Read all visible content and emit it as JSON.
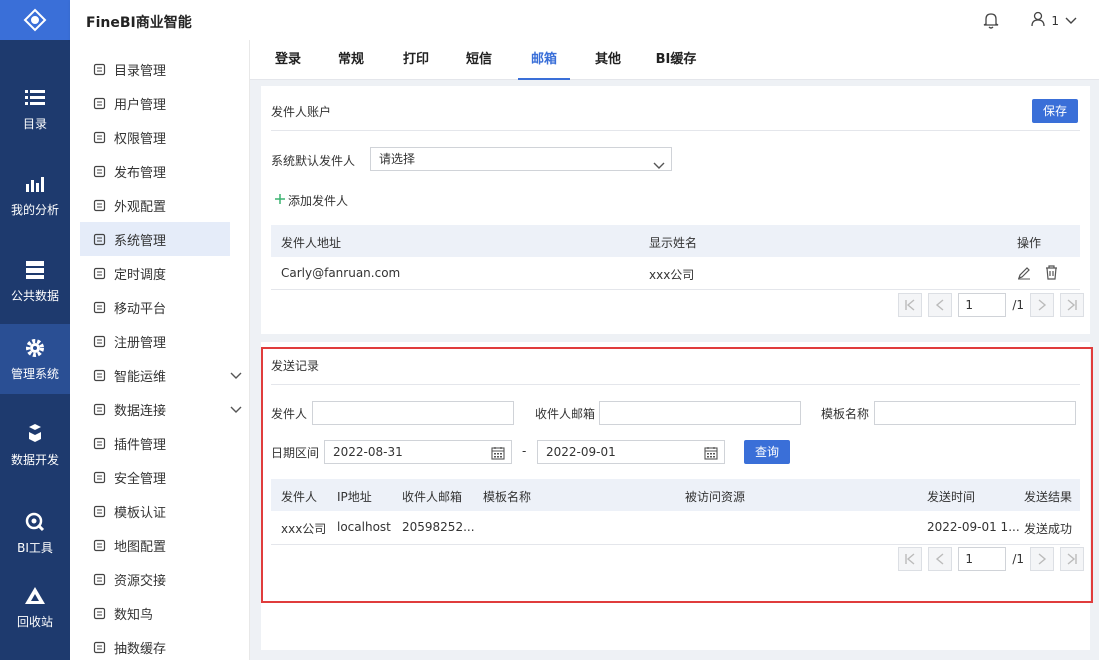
{
  "app": {
    "title": "FineBI商业智能",
    "user_name": "1"
  },
  "leftbar": [
    {
      "label": "目录",
      "icon": "list-icon"
    },
    {
      "label": "我的分析",
      "icon": "chart-icon"
    },
    {
      "label": "公共数据",
      "icon": "database-icon"
    },
    {
      "label": "管理系统",
      "icon": "gear-icon"
    },
    {
      "label": "数据开发",
      "icon": "cubes-icon"
    },
    {
      "label": "BI工具",
      "icon": "wrench-icon"
    },
    {
      "label": "回收站",
      "icon": "recycle-icon"
    }
  ],
  "nav": [
    {
      "label": "目录管理"
    },
    {
      "label": "用户管理"
    },
    {
      "label": "权限管理"
    },
    {
      "label": "发布管理"
    },
    {
      "label": "外观配置"
    },
    {
      "label": "系统管理"
    },
    {
      "label": "定时调度"
    },
    {
      "label": "移动平台"
    },
    {
      "label": "注册管理"
    },
    {
      "label": "智能运维"
    },
    {
      "label": "数据连接"
    },
    {
      "label": "插件管理"
    },
    {
      "label": "安全管理"
    },
    {
      "label": "模板认证"
    },
    {
      "label": "地图配置"
    },
    {
      "label": "资源交接"
    },
    {
      "label": "数知鸟"
    },
    {
      "label": "抽数缓存"
    }
  ],
  "tabs": [
    "登录",
    "常规",
    "打印",
    "短信",
    "邮箱",
    "其他",
    "BI缓存"
  ],
  "sender": {
    "title": "发件人账户",
    "save": "保存",
    "default_label": "系统默认发件人",
    "default_value": "请选择",
    "add": "添加发件人",
    "headers": [
      "发件人地址",
      "显示姓名",
      "操作"
    ],
    "rows": [
      {
        "address": "Carly@fanruan.com",
        "name": "xxx公司"
      }
    ],
    "page": "1",
    "total": "/1"
  },
  "log": {
    "title": "发送记录",
    "sender_label": "发件人",
    "recipient_label": "收件人邮箱",
    "template_label": "模板名称",
    "date_label": "日期区间",
    "date_from": "2022-08-31",
    "date_sep": "-",
    "date_to": "2022-09-01",
    "query": "查询",
    "headers": [
      "发件人",
      "IP地址",
      "收件人邮箱",
      "模板名称",
      "被访问资源",
      "发送时间",
      "发送结果"
    ],
    "rows": [
      {
        "sender": "xxx公司",
        "ip": "localhost",
        "recipient": "20598252...",
        "template": "",
        "resource": "",
        "time": "2022-09-01 1...",
        "result": "发送成功"
      }
    ],
    "page": "1",
    "total": "/1"
  }
}
